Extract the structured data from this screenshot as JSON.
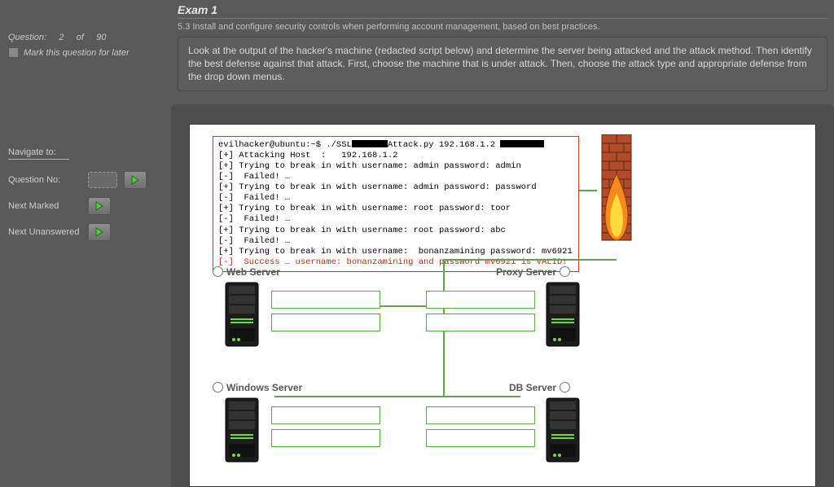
{
  "sidebar": {
    "question_label": "Question:",
    "question_current": "2",
    "question_of": "of",
    "question_total": "90",
    "mark_later": "Mark this question for later",
    "nav_title": "Navigate to:",
    "rows": [
      {
        "label": "Question No:"
      },
      {
        "label": "Next Marked"
      },
      {
        "label": "Next Unanswered"
      }
    ]
  },
  "exam": {
    "title": "Exam 1",
    "objective": "5.3 Install and configure security controls when performing account management, based on best practices.",
    "instructions": "Look at the output of the hacker's machine (redacted script below) and determine the server being attacked and the attack method. Then identify the best defense against that attack. First, choose the machine that is under attack. Then, choose the attack type and appropriate defense from the drop down menus."
  },
  "terminal": {
    "prompt": "evilhacker@ubuntu:~$ ./SSL",
    "attack_suffix": "Attack.py 192.168.1.2 ",
    "lines": [
      "[+] Attacking Host  :   192.168.1.2",
      "[+] Trying to break in with username: admin password: admin",
      "[-]  Failed! …",
      "[+] Trying to break in with username: admin password: password",
      "[-]  Failed! …",
      "[+] Trying to break in with username: root password: toor",
      "[-]  Failed! …",
      "[+] Trying to break in with username: root password: abc",
      "[-]  Failed! …",
      "[+] Trying to break in with username:  bonanzamining password: mv6921"
    ],
    "success": "[-]  Success … username: bonanzamining and password mv6921 is VALID!"
  },
  "servers": {
    "web": "Web Server",
    "proxy": "Proxy Server",
    "windows": "Windows Server",
    "db": "DB Server"
  }
}
